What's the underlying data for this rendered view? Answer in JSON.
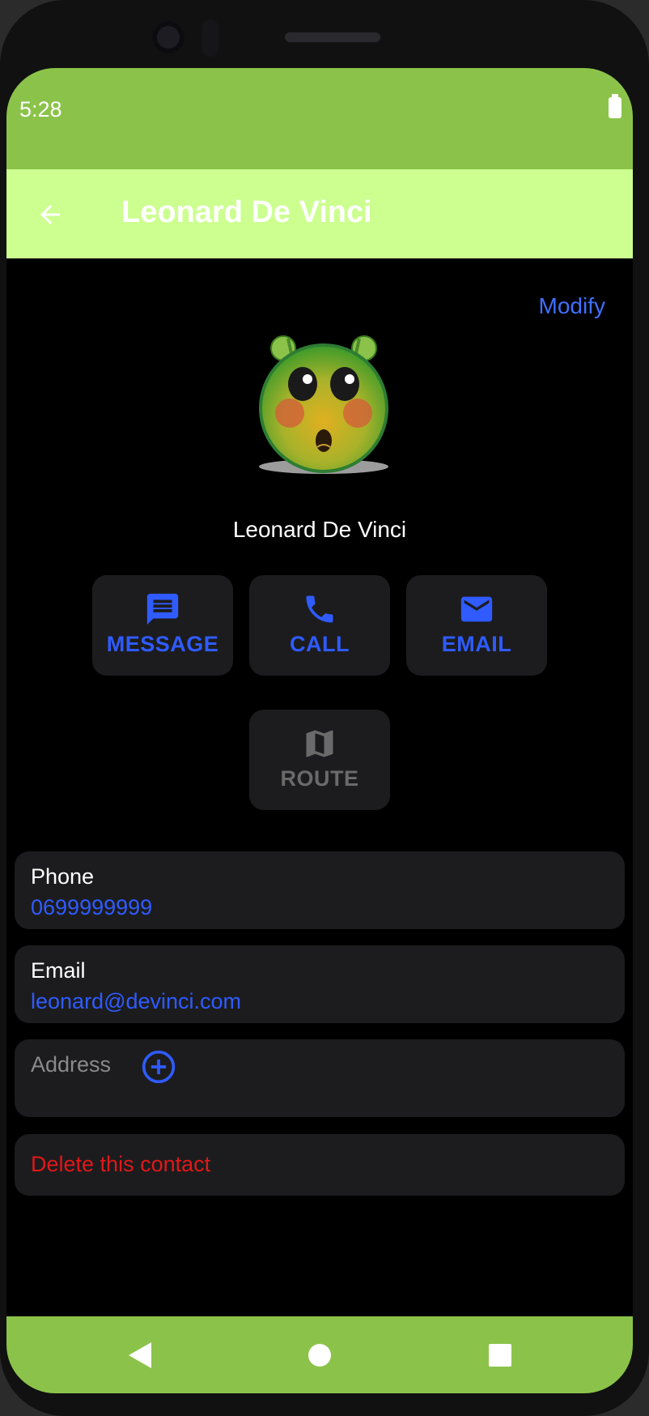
{
  "status_bar": {
    "time": "5:28"
  },
  "app_bar": {
    "title": "Leonard De Vinci"
  },
  "header": {
    "modify_label": "Modify"
  },
  "contact": {
    "name": "Leonard De Vinci"
  },
  "actions": [
    {
      "label": "MESSAGE",
      "icon": "message-icon"
    },
    {
      "label": "CALL",
      "icon": "phone-icon"
    },
    {
      "label": "EMAIL",
      "icon": "email-icon"
    },
    {
      "label": "ROUTE",
      "icon": "map-icon"
    }
  ],
  "fields": {
    "phone": {
      "label": "Phone",
      "value": "0699999999"
    },
    "email": {
      "label": "Email",
      "value": "leonard@devinci.com"
    },
    "address": {
      "label": "Address"
    }
  },
  "delete_label": "Delete this contact",
  "colors": {
    "status_bar": "#8bc34a",
    "app_bar": "#ccff90",
    "accent": "#2f5bff",
    "danger": "#e01818"
  }
}
